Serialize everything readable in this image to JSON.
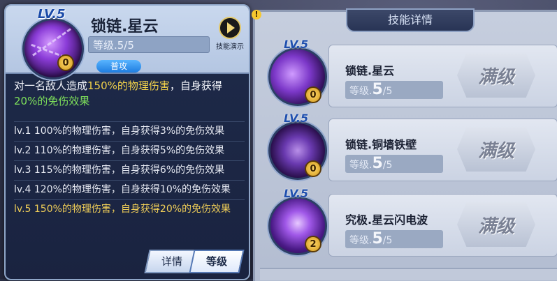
{
  "left": {
    "lv_badge": "LV.5",
    "skill_name": "锁链.星云",
    "level_text": "等级.5/5",
    "rank": "0",
    "tag": "普攻",
    "demo_label": "技能演示",
    "desc_parts": [
      "对一名敌人造成",
      "150%的物理伤害",
      "，自身获得",
      "20%的免伤效果"
    ],
    "levels": [
      "lv.1 100%的物理伤害，自身获得3%的免伤效果",
      "lv.2 110%的物理伤害，自身获得5%的免伤效果",
      "lv.3 115%的物理伤害，自身获得6%的免伤效果",
      "lv.4 120%的物理伤害，自身获得10%的免伤效果",
      "lv.5 150%的物理伤害，自身获得20%的免伤效果"
    ],
    "btn_detail": "详情",
    "btn_level": "等级"
  },
  "right": {
    "alert": "!",
    "tab_title": "技能详情",
    "skills": [
      {
        "lv": "LV.5",
        "name": "锁链.星云",
        "level_label": "等级.",
        "level_value": "5",
        "level_max": "/5",
        "rank": "0",
        "status": "满级"
      },
      {
        "lv": "LV.5",
        "name": "锁链.铜墙铁壁",
        "level_label": "等级.",
        "level_value": "5",
        "level_max": "/5",
        "rank": "0",
        "status": "满级"
      },
      {
        "lv": "LV.5",
        "name": "究极.星云闪电波",
        "level_label": "等级.",
        "level_value": "5",
        "level_max": "/5",
        "rank": "2",
        "status": "满级"
      }
    ]
  }
}
